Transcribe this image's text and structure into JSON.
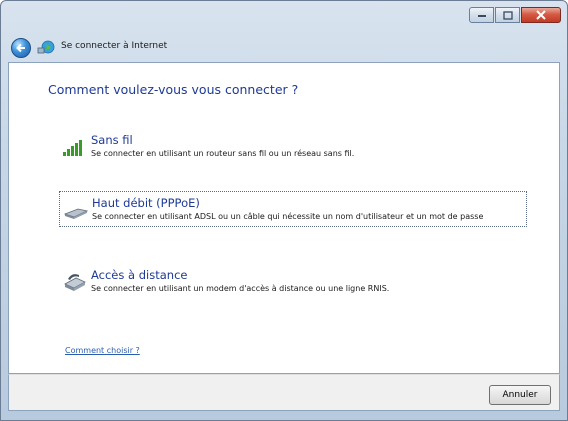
{
  "window": {
    "title": "Se connecter à Internet",
    "controls": [
      "minimize-icon",
      "maximize-icon",
      "close-icon"
    ]
  },
  "main": {
    "heading": "Comment voulez-vous vous connecter ?",
    "options": [
      {
        "title": "Sans fil",
        "description": "Se connecter en utilisant un routeur sans fil ou un réseau sans fil.",
        "icon": "wireless-signal-icon",
        "selected": false
      },
      {
        "title": "Haut débit (PPPoE)",
        "description": "Se connecter en utilisant ADSL ou un câble qui nécessite un nom d'utilisateur et un mot de passe",
        "icon": "broadband-modem-icon",
        "selected": true
      },
      {
        "title": "Accès à distance",
        "description": "Se connecter en utilisant un modem d'accès à distance ou une ligne RNIS.",
        "icon": "dialup-modem-icon",
        "selected": false
      }
    ],
    "help_link": "Comment choisir ?"
  },
  "footer": {
    "cancel_label": "Annuler"
  },
  "colors": {
    "heading": "#1e3a96",
    "link": "#2a5db0",
    "close_button": "#c23a23"
  }
}
